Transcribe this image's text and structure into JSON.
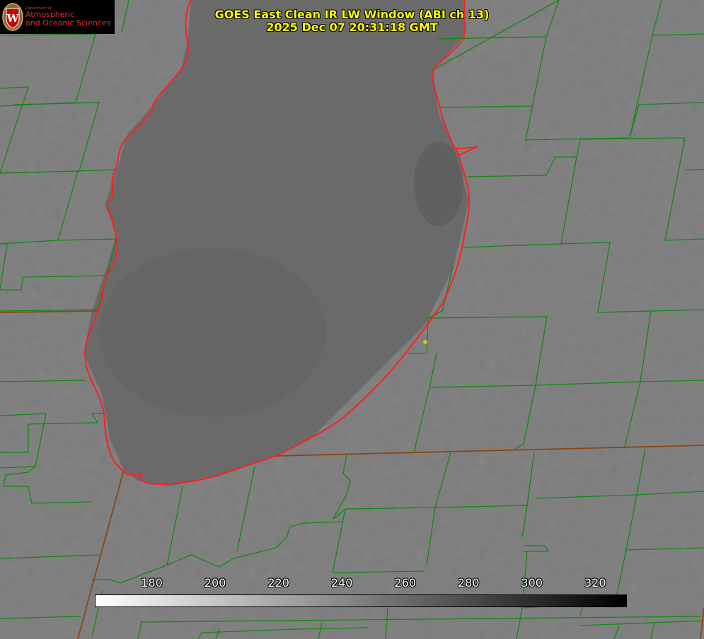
{
  "title": {
    "line1": "GOES East Clean IR LW Window (ABI ch 13)",
    "line2": "2025 Dec 07 20:31:18 GMT"
  },
  "logo": {
    "dept": "Department of",
    "line1": "Atmospheric",
    "line2": "and Oceanic Sciences",
    "seal_letter": "W"
  },
  "colorbar": {
    "min": 162,
    "max": 330,
    "ticks": [
      180,
      200,
      220,
      240,
      260,
      280,
      300,
      320
    ],
    "tick_labels": [
      "180",
      "200",
      "220",
      "240",
      "260",
      "280",
      "300",
      "320"
    ],
    "low_color": "#ffffff",
    "high_color": "#000000"
  },
  "colors": {
    "title": "#ffff00",
    "county_lines": "#138813",
    "lake_shore": "#ff2020",
    "state_line": "#8b4513",
    "marker": "#e0c020",
    "land": "#7d7d7d",
    "lake": "#6a6a6a"
  }
}
